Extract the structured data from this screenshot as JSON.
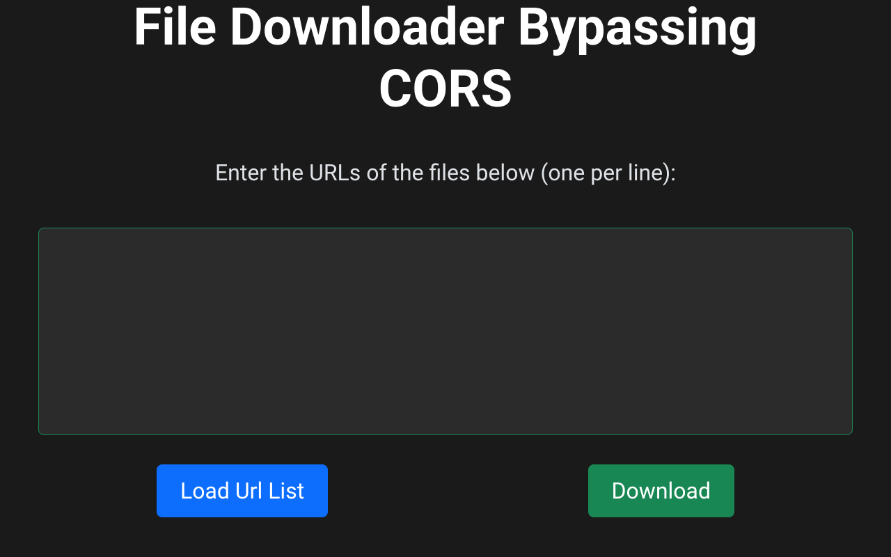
{
  "header": {
    "title": "File Downloader Bypassing CORS",
    "subtitle": "Enter the URLs of the files below (one per line):"
  },
  "input": {
    "urls_value": ""
  },
  "buttons": {
    "load_label": "Load Url List",
    "download_label": "Download"
  },
  "colors": {
    "background": "#1a1a1a",
    "primary": "#0d6efd",
    "success": "#198754",
    "input_bg": "#2b2b2b"
  }
}
